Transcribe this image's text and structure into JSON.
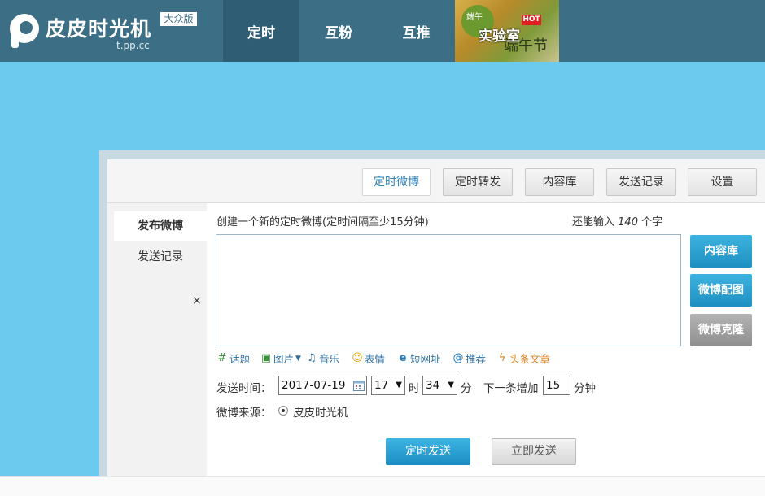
{
  "topbar": {
    "logo_name": "皮皮时光机",
    "logo_badge": "大众版",
    "logo_url": "t.pp.cc",
    "nav": [
      {
        "label": "定时"
      },
      {
        "label": "互粉"
      },
      {
        "label": "互推"
      },
      {
        "label": "实验室"
      }
    ],
    "lab_banner": {
      "hot": "HOT",
      "top_text": "端午",
      "calligraphy": "端午节"
    },
    "colors": {
      "bar": "#3c6f86",
      "active": "#2f5e74"
    }
  },
  "tabs": [
    {
      "label": "定时微博",
      "active": true
    },
    {
      "label": "定时转发"
    },
    {
      "label": "内容库"
    },
    {
      "label": "发送记录"
    },
    {
      "label": "设置"
    }
  ],
  "sidebar": {
    "items": [
      {
        "label": "发布微博",
        "active": true
      },
      {
        "label": "发送记录"
      }
    ],
    "close": "×"
  },
  "compose": {
    "title": "创建一个新的定时微博(定时间隔至少15分钟)",
    "remain_prefix": "还能输入",
    "remain_count": "140",
    "remain_suffix": "个字",
    "text_value": ""
  },
  "right_buttons": [
    {
      "label": "内容库"
    },
    {
      "label": "微博配图"
    },
    {
      "label": "微博克隆"
    }
  ],
  "toolbar": [
    {
      "label": "话题",
      "icon": "topic-icon"
    },
    {
      "label": "图片",
      "icon": "image-icon"
    },
    {
      "label": "音乐",
      "icon": "music-icon"
    },
    {
      "label": "表情",
      "icon": "emoji-icon"
    },
    {
      "label": "短网址",
      "icon": "short-url-icon"
    },
    {
      "label": "推荐",
      "icon": "recommend-icon"
    },
    {
      "label": "头条文章",
      "icon": "lightning-icon"
    }
  ],
  "schedule": {
    "label": "发送时间：",
    "date": "2017-07-19",
    "hour": "17",
    "hour_unit": "时",
    "minute": "34",
    "minute_unit": "分",
    "increment_label": "下一条增加",
    "increment_value": "15",
    "increment_unit": "分钟"
  },
  "source": {
    "label": "微博来源：",
    "option": "皮皮时光机"
  },
  "actions": {
    "schedule_send": "定时发送",
    "send_now": "立即发送"
  }
}
